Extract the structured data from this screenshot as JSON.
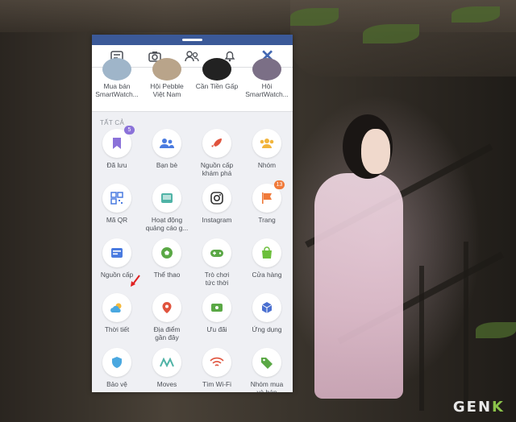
{
  "watermark": {
    "prefix": "GEN",
    "suffix": "K"
  },
  "toolbar": {
    "icons": [
      "feed-icon",
      "camera-icon",
      "friends-icon",
      "bell-icon",
      "close-icon"
    ]
  },
  "groups": [
    {
      "line1": "Mua bán",
      "line2": "SmartWatch..."
    },
    {
      "line1": "Hội Pebble",
      "line2": "Việt Nam"
    },
    {
      "line1": "Cần Tiền Gấp",
      "line2": ""
    },
    {
      "line1": "Hội",
      "line2": "SmartWatch..."
    }
  ],
  "section_title": "TẤT CẢ",
  "tiles": [
    {
      "label": "Đã lưu",
      "icon": "bookmark-icon",
      "color": "#8b72d9",
      "badge": "5",
      "badge_color": "#8b72d9"
    },
    {
      "label": "Bạn bè",
      "icon": "friends-icon",
      "color": "#4a7be0"
    },
    {
      "label": "Nguồn cấp\nkhám phá",
      "icon": "rocket-icon",
      "color": "#e0533d"
    },
    {
      "label": "Nhóm",
      "icon": "groups-icon",
      "color": "#f2b53c"
    },
    {
      "label": "Mã QR",
      "icon": "qr-icon",
      "color": "#4a7be0"
    },
    {
      "label": "Hoạt động\nquảng cáo g...",
      "icon": "ads-icon",
      "color": "#4fb3a6"
    },
    {
      "label": "Instagram",
      "icon": "instagram-icon",
      "color": "#333333"
    },
    {
      "label": "Trang",
      "icon": "flag-icon",
      "color": "#f07a3a",
      "badge": "13",
      "badge_color": "#f07a3a"
    },
    {
      "label": "Nguồn cấp",
      "icon": "feed-icon",
      "color": "#4a7be0"
    },
    {
      "label": "Thể thao",
      "icon": "soccer-icon",
      "color": "#5aa845"
    },
    {
      "label": "Trò chơi\ntức thời",
      "icon": "gamepad-icon",
      "color": "#5aa845"
    },
    {
      "label": "Cửa hàng",
      "icon": "shopping-bag-icon",
      "color": "#6cbf3c"
    },
    {
      "label": "Thời tiết",
      "icon": "weather-icon",
      "color": "#4aa8e0"
    },
    {
      "label": "Địa điểm\ngần đây",
      "icon": "location-pin-icon",
      "color": "#e0533d"
    },
    {
      "label": "Ưu đãi",
      "icon": "offers-icon",
      "color": "#5aa845"
    },
    {
      "label": "Ứng dụng",
      "icon": "cube-icon",
      "color": "#4a6fd0"
    },
    {
      "label": "Bảo vệ",
      "icon": "shield-icon",
      "color": "#4aa8e0"
    },
    {
      "label": "Moves",
      "icon": "moves-icon",
      "color": "#4fb3a6"
    },
    {
      "label": "Tìm Wi-Fi",
      "icon": "wifi-icon",
      "color": "#e0533d"
    },
    {
      "label": "Nhóm mua\nvà bán",
      "icon": "tag-icon",
      "color": "#5aa845"
    }
  ]
}
